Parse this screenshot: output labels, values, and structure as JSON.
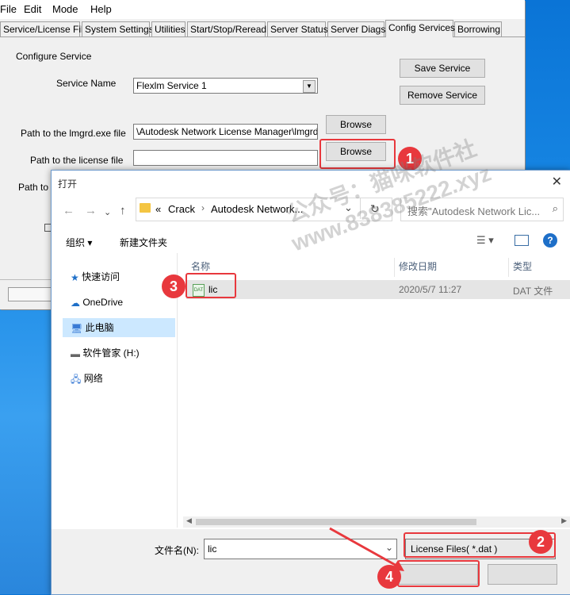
{
  "lmtools": {
    "menu": [
      "File",
      "Edit",
      "Mode",
      "Help"
    ],
    "tabs": [
      "Service/License File",
      "System Settings",
      "Utilities",
      "Start/Stop/Reread",
      "Server Status",
      "Server Diags",
      "Config Services",
      "Borrowing"
    ],
    "active_tab": "Config Services",
    "configure_service_label": "Configure Service",
    "service_name_label": "Service Name",
    "service_name_value": "Flexlm Service 1",
    "save_service": "Save Service",
    "remove_service": "Remove Service",
    "lmgrd_label": "Path to the lmgrd.exe file",
    "lmgrd_value": "\\Autodesk Network License Manager\\lmgrd.exe",
    "license_label": "Path to the license file",
    "license_value": "",
    "debug_label_partial": "Path to th",
    "browse": "Browse"
  },
  "dialog": {
    "title": "打开",
    "breadcrumb": [
      "«",
      "Crack",
      "Autodesk Network..."
    ],
    "search_placeholder": "搜索\"Autodesk Network Lic...",
    "organize": "组织 ▾",
    "new_folder": "新建文件夹",
    "sidebar": [
      "快速访问",
      "OneDrive",
      "此电脑",
      "软件管家 (H:)",
      "网络"
    ],
    "selected_sidebar": "此电脑",
    "columns": {
      "name": "名称",
      "date": "修改日期",
      "type": "类型"
    },
    "files": [
      {
        "name": "lic",
        "date": "2020/5/7 11:27",
        "type": "DAT 文件"
      }
    ],
    "filename_label": "文件名(N):",
    "filename_value": "lic",
    "filetype": "License Files( *.dat )"
  },
  "watermark": {
    "line1": "公众号：猫咪软件社",
    "line2": "www.838385222.xyz"
  },
  "annotations": [
    "1",
    "2",
    "3",
    "4"
  ],
  "colors": {
    "accent_red": "#e8383d",
    "selection": "#cce8ff",
    "desktop": "#1a8ae6"
  }
}
